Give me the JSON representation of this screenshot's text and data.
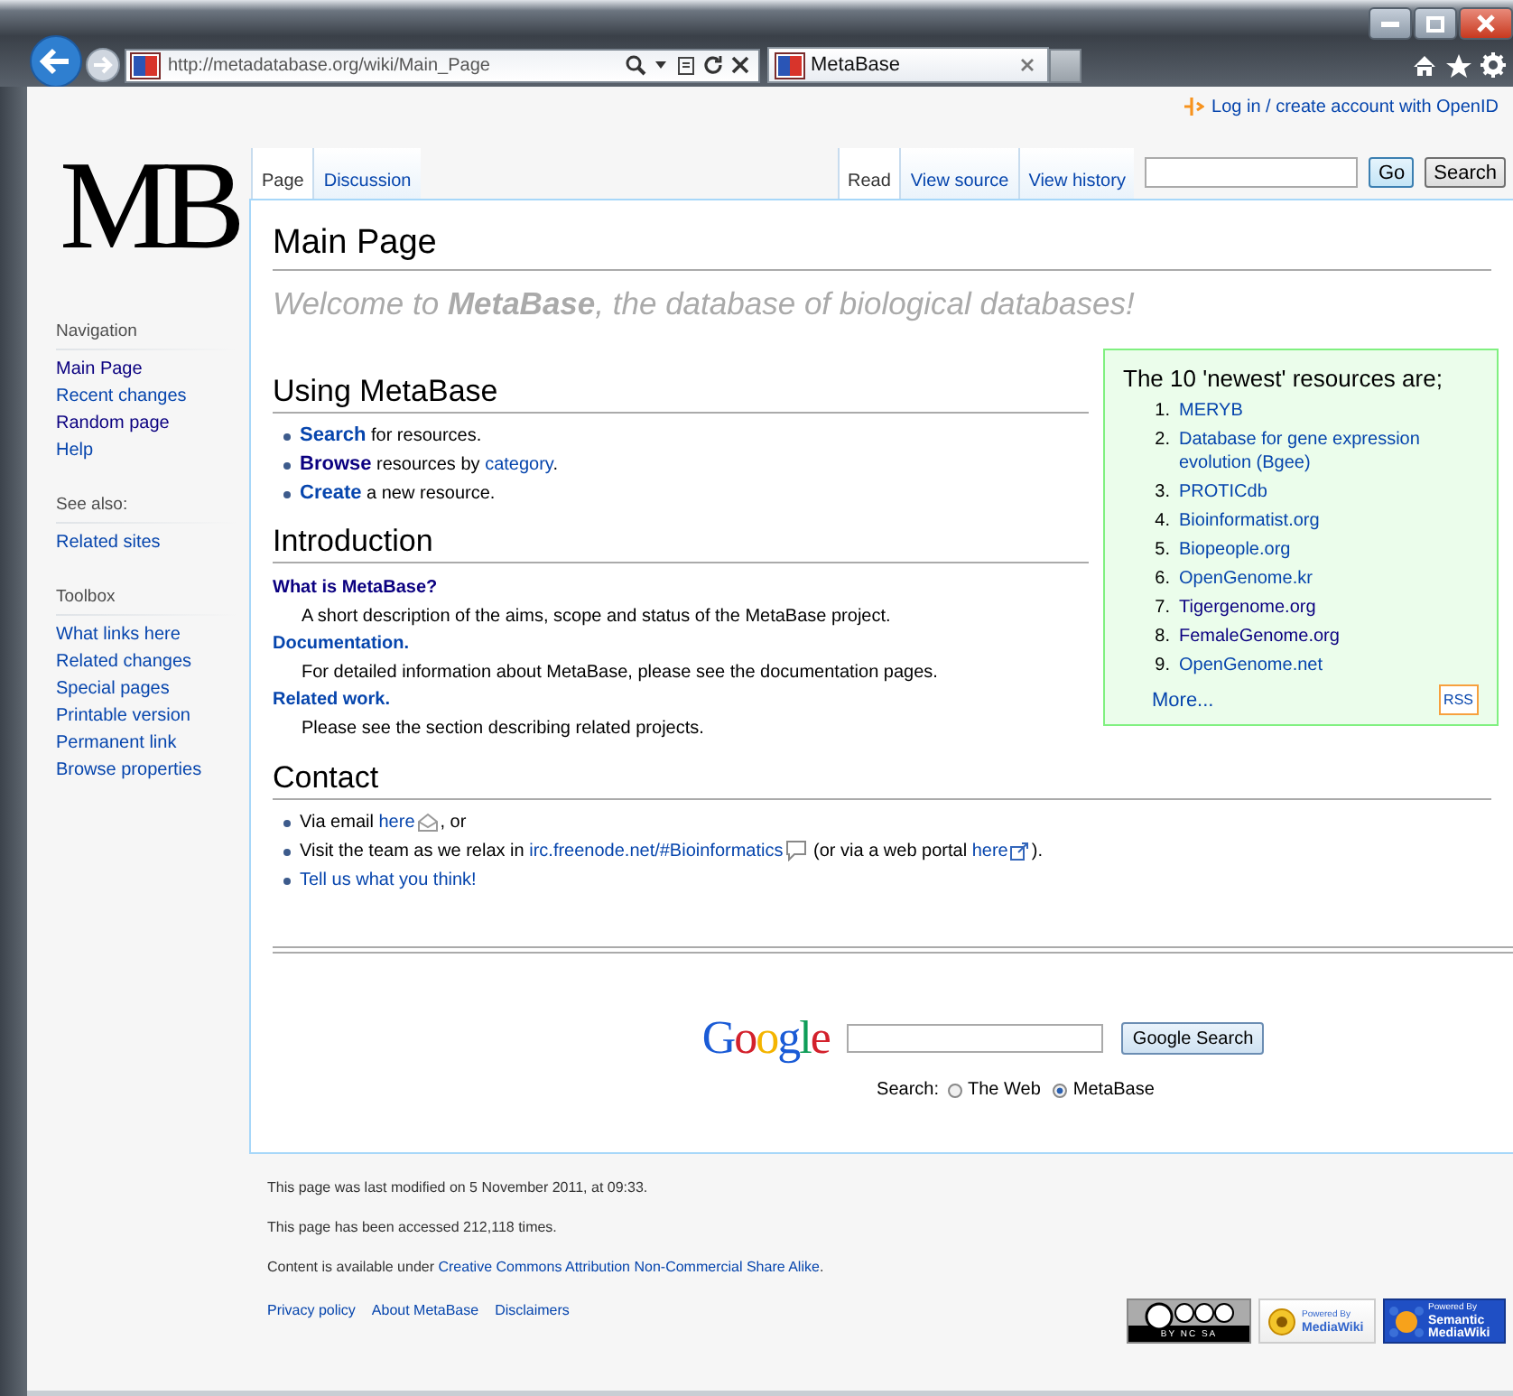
{
  "browser": {
    "address": "http://metadatabase.org/wiki/Main_Page",
    "tab": {
      "title": "MetaBase"
    }
  },
  "personal_tools": {
    "link": "Log in / create account with OpenID"
  },
  "logo": "MB",
  "page_tabs": [
    {
      "label": "Page",
      "selected": true
    },
    {
      "label": "Discussion",
      "selected": false
    }
  ],
  "view_tabs": [
    {
      "label": "Read",
      "selected": true
    },
    {
      "label": "View source",
      "selected": false
    },
    {
      "label": "View history",
      "selected": false
    }
  ],
  "search": {
    "buttons": [
      "Go",
      "Search"
    ]
  },
  "sidebar": [
    {
      "heading": "Navigation",
      "items": [
        {
          "label": "Main Page",
          "visited": true
        },
        {
          "label": "Recent changes",
          "visited": false
        },
        {
          "label": "Random page",
          "visited": true
        },
        {
          "label": "Help",
          "visited": false
        }
      ]
    },
    {
      "heading": "See also:",
      "items": [
        {
          "label": "Related sites",
          "visited": false
        }
      ]
    },
    {
      "heading": "Toolbox",
      "items": [
        {
          "label": "What links here",
          "visited": false
        },
        {
          "label": "Related changes",
          "visited": false
        },
        {
          "label": "Special pages",
          "visited": false
        },
        {
          "label": "Printable version",
          "visited": false
        },
        {
          "label": "Permanent link",
          "visited": false
        },
        {
          "label": "Browse properties",
          "visited": false
        }
      ]
    }
  ],
  "title": "Main Page",
  "welcome": "Welcome to **MetaBase**, the database of biological databases!",
  "newest": {
    "title": "The 10 'newest' resources are;",
    "items": [
      {
        "number": "1.",
        "label": "MERYB",
        "visited": false
      },
      {
        "number": "2.",
        "label": "Database for gene expression evolution (Bgee)",
        "visited": false
      },
      {
        "number": "3.",
        "label": "PROTICdb",
        "visited": false
      },
      {
        "number": "4.",
        "label": "Bioinformatist.org",
        "visited": false
      },
      {
        "number": "5.",
        "label": "Biopeople.org",
        "visited": false
      },
      {
        "number": "6.",
        "label": "OpenGenome.kr",
        "visited": false
      },
      {
        "number": "7.",
        "label": "Tigergenome.org",
        "visited": true
      },
      {
        "number": "8.",
        "label": "FemaleGenome.org",
        "visited": true
      },
      {
        "number": "9.",
        "label": "OpenGenome.net",
        "visited": false
      }
    ],
    "more": "More...",
    "rss": "RSS"
  },
  "sections": [
    {
      "kind": "list",
      "heading": "Using MetaBase",
      "items": [
        [
          {
            "kind": "link",
            "text": "Search",
            "bold": true,
            "visited": false
          },
          {
            "kind": "plain",
            "text": " for resources."
          }
        ],
        [
          {
            "kind": "link",
            "text": "Browse",
            "bold": true,
            "visited": true
          },
          {
            "kind": "plain",
            "text": " resources by "
          },
          {
            "kind": "link",
            "text": "category",
            "bold": false,
            "visited": false
          },
          {
            "kind": "plain",
            "text": "."
          }
        ],
        [
          {
            "kind": "link",
            "text": "Create",
            "bold": true,
            "visited": false
          },
          {
            "kind": "plain",
            "text": " a new resource."
          }
        ]
      ]
    },
    {
      "kind": "definitions",
      "heading": "Introduction",
      "items": [
        {
          "term": "What is MetaBase?",
          "visited": true,
          "text": "A short description of the aims, scope and status of the MetaBase project."
        },
        {
          "term": "Documentation.",
          "visited": false,
          "text": "For detailed information about MetaBase, please see the documentation pages."
        },
        {
          "term": "Related work.",
          "visited": false,
          "text": "Please see the section describing related projects."
        }
      ]
    },
    {
      "kind": "list",
      "heading": "Contact",
      "items": [
        [
          {
            "kind": "plain",
            "text": "Via email "
          },
          {
            "kind": "mail_link",
            "text": "here",
            "bold": false,
            "visited": false
          },
          {
            "kind": "plain",
            "text": ", or"
          }
        ],
        [
          {
            "kind": "plain",
            "text": "Visit the team as we relax in "
          },
          {
            "kind": "chat_link",
            "text": "irc.freenode.net/#Bioinformatics",
            "bold": false,
            "visited": false
          },
          {
            "kind": "plain",
            "text": " (or via a web portal "
          },
          {
            "kind": "external_link",
            "text": "here",
            "bold": false,
            "visited": false
          },
          {
            "kind": "plain",
            "text": ")."
          }
        ],
        [
          {
            "kind": "link",
            "text": "Tell us what you think!",
            "bold": false,
            "visited": false
          }
        ]
      ]
    }
  ],
  "google": {
    "logo": "Google",
    "button": "Google Search",
    "label": "Search:",
    "options": [
      {
        "label": "The Web",
        "selected": false
      },
      {
        "label": "MetaBase",
        "selected": true
      }
    ]
  },
  "footer": {
    "lines": [
      [
        {
          "kind": "plain",
          "text": "This page was last modified on 5 November 2011, at 09:33."
        }
      ],
      [
        {
          "kind": "plain",
          "text": "This page has been accessed 212,118 times."
        }
      ],
      [
        {
          "kind": "plain",
          "text": "Content is available under "
        },
        {
          "kind": "link",
          "text": "Creative Commons Attribution Non-Commercial Share Alike",
          "bold": false,
          "visited": false
        },
        {
          "kind": "plain",
          "text": "."
        }
      ]
    ],
    "links": [
      "Privacy policy",
      "About MetaBase",
      "Disclaimers"
    ],
    "badges": [
      {
        "kind": "cc",
        "lines": [
          "BY NC SA"
        ]
      },
      {
        "kind": "mediawiki",
        "lines": [
          "Powered By",
          "MediaWiki"
        ]
      },
      {
        "kind": "smw",
        "lines": [
          "Powered By",
          "Semantic",
          "MediaWiki"
        ]
      }
    ]
  }
}
